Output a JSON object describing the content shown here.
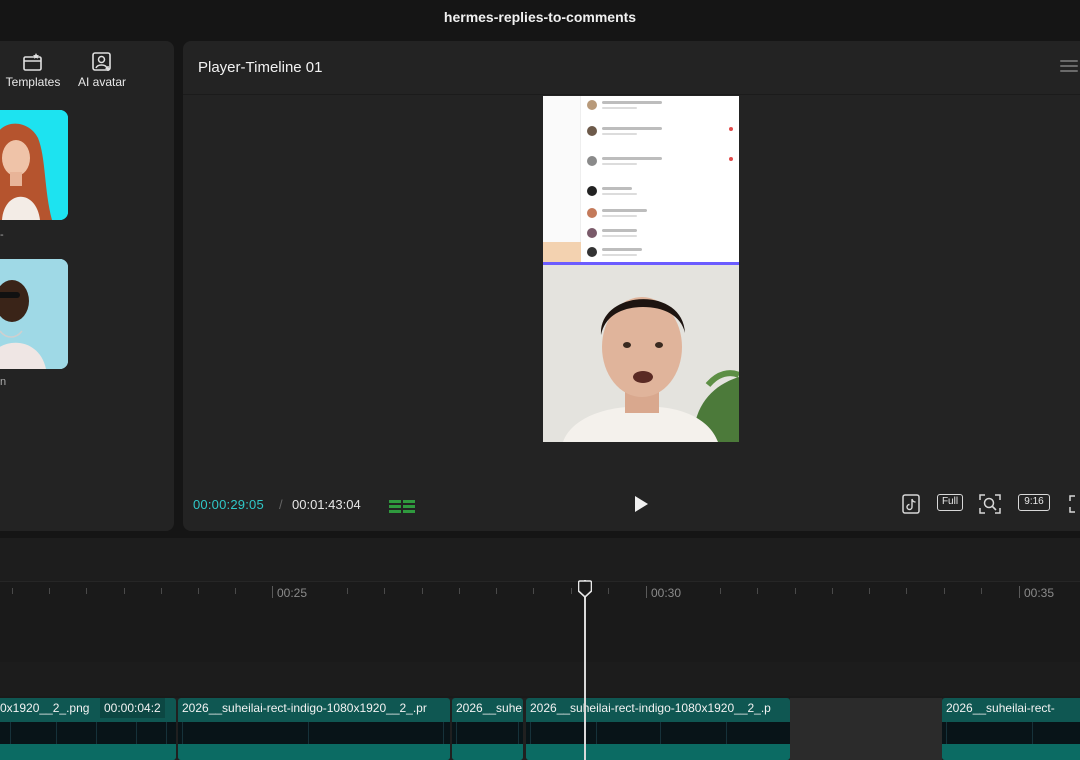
{
  "window": {
    "title": "hermes-replies-to-comments"
  },
  "left_panel": {
    "tools": [
      {
        "label": "Templates",
        "icon": "templates-icon"
      },
      {
        "label": "AI avatar",
        "icon": "ai-avatar-icon"
      }
    ],
    "avatar_captions": [
      "-",
      "n"
    ]
  },
  "player": {
    "title": "Player-Timeline 01",
    "current_time": "00:00:29:05",
    "separator": "/",
    "total_time": "00:01:43:04",
    "controls": {
      "full_label": "Full",
      "ratio_label": "9:16"
    },
    "accent_color": "#2fc8c8"
  },
  "timeline": {
    "ruler_labels": [
      "00:25",
      "00:30",
      "00:35"
    ],
    "clips": [
      {
        "name": "0x1920__2_.png",
        "duration": "00:00:04:2"
      },
      {
        "name": "2026__suheilai-rect-indigo-1080x1920__2_.pr"
      },
      {
        "name": "2026__suhe"
      },
      {
        "name": "2026__suheilai-rect-indigo-1080x1920__2_.p"
      },
      {
        "name": "2026__suheilai-rect-"
      }
    ],
    "clip_color": "#0f5752"
  }
}
